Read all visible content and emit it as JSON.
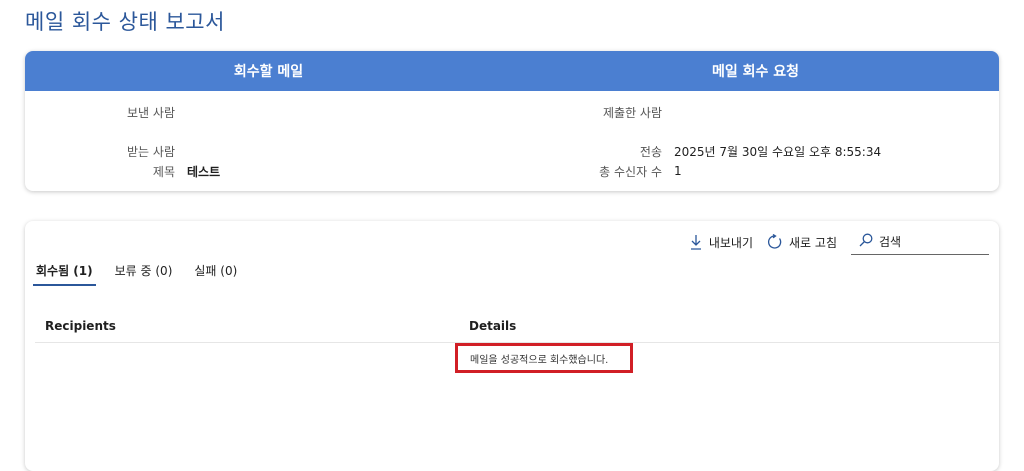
{
  "page": {
    "title": "메일 회수 상태 보고서"
  },
  "summary": {
    "left_header": "회수할 메일",
    "right_header": "메일 회수 요청",
    "sender_label": "보낸 사람",
    "sender_value": "",
    "recipient_label": "받는 사람",
    "recipient_value": "",
    "subject_label": "제목",
    "subject_value": "테스트",
    "submitter_label": "제출한 사람",
    "submitter_value": "",
    "sent_label": "전송",
    "sent_value": "2025년 7월 30일 수요일 오후 8:55:34",
    "total_recipients_label": "총 수신자 수",
    "total_recipients_value": "1"
  },
  "toolbar": {
    "export_label": "내보내기",
    "refresh_label": "새로 고침",
    "search_placeholder": "검색"
  },
  "tabs": [
    {
      "label": "회수됨 (1)",
      "active": true
    },
    {
      "label": "보류 중 (0)",
      "active": false
    },
    {
      "label": "실패 (0)",
      "active": false
    }
  ],
  "table": {
    "columns": [
      "Recipients",
      "Details"
    ],
    "rows": [
      {
        "recipient": "",
        "details": "메일을 성공적으로 회수했습니다."
      }
    ]
  },
  "colors": {
    "header_blue": "#4b7fd1",
    "title_blue": "#2b579a",
    "highlight_red": "#d11f26"
  }
}
